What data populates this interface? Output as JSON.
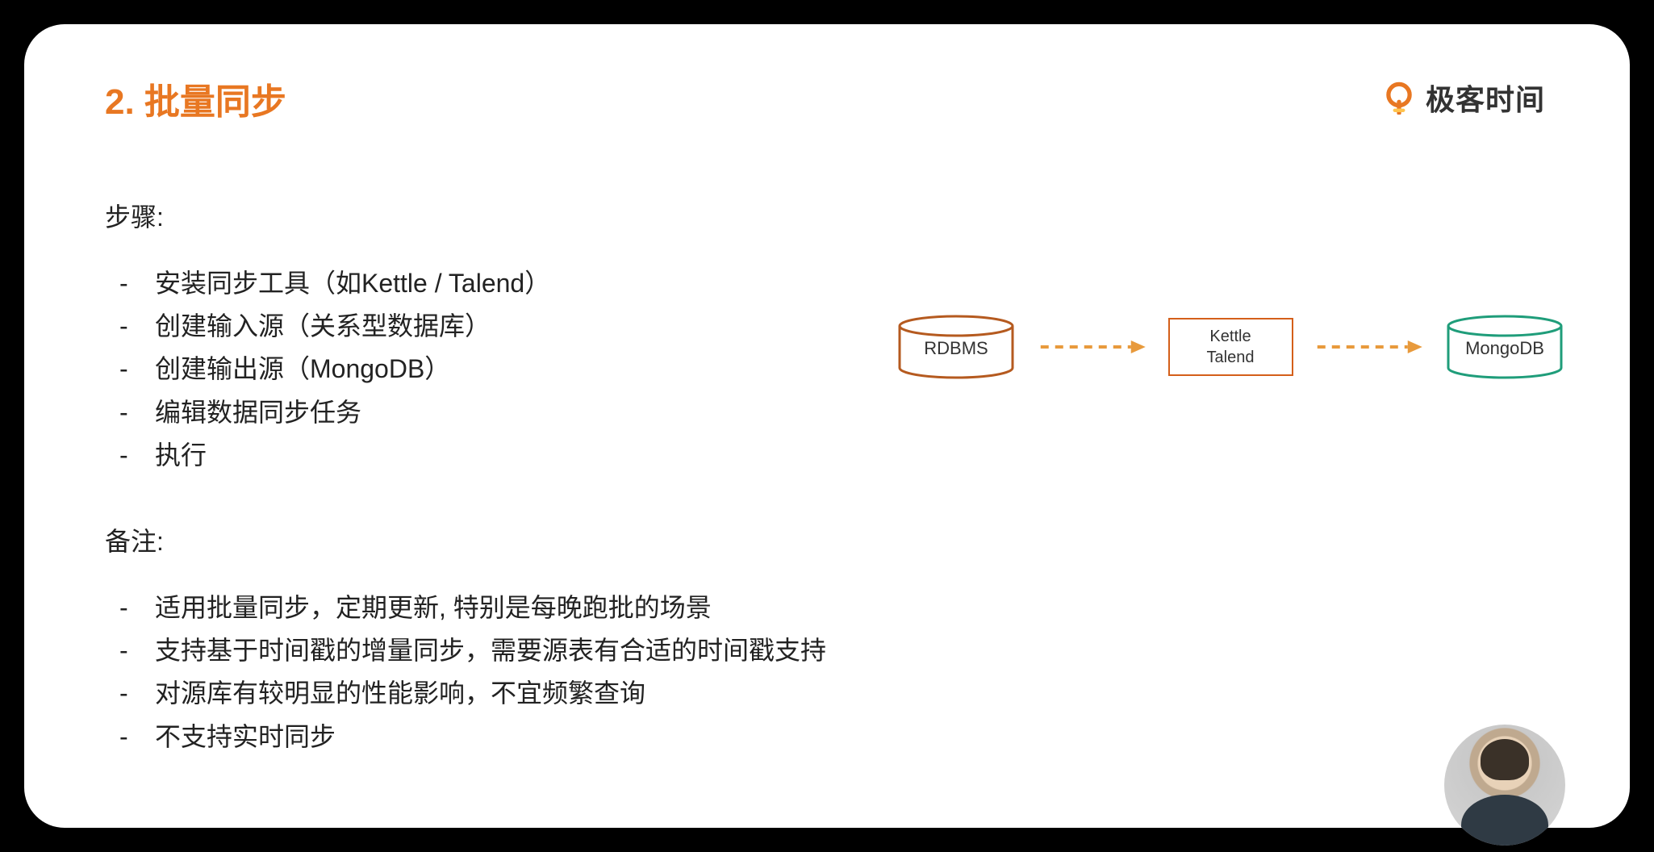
{
  "title": "2. 批量同步",
  "brand": "极客时间",
  "steps_label": "步骤:",
  "steps": [
    "安装同步工具（如Kettle / Talend）",
    "创建输入源（关系型数据库）",
    "创建输出源（MongoDB）",
    "编辑数据同步任务",
    "执行"
  ],
  "notes_label": "备注:",
  "notes": [
    "适用批量同步，定期更新, 特别是每晚跑批的场景",
    "支持基于时间戳的增量同步，需要源表有合适的时间戳支持",
    "对源库有较明显的性能影响，不宜频繁查询",
    "不支持实时同步"
  ],
  "diagram": {
    "source": "RDBMS",
    "tool_line1": "Kettle",
    "tool_line2": "Talend",
    "target": "MongoDB"
  },
  "colors": {
    "accent_orange": "#e87722",
    "diagram_orange": "#d45f1a",
    "diagram_green": "#1f9d7a"
  }
}
